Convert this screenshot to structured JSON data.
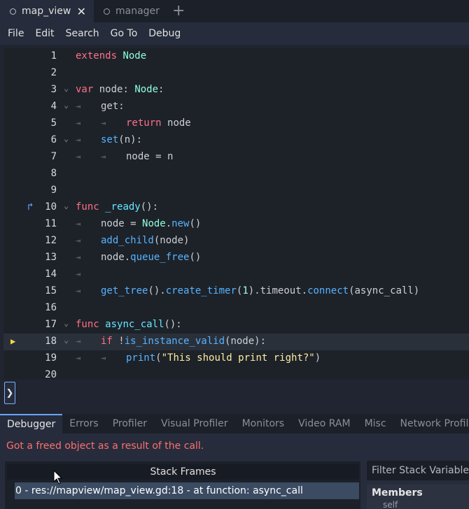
{
  "tabs": [
    {
      "label": "map_view",
      "active": true
    },
    {
      "label": "manager",
      "active": false
    }
  ],
  "menu": [
    "File",
    "Edit",
    "Search",
    "Go To",
    "Debug"
  ],
  "editor": {
    "lines": [
      {
        "n": "1"
      },
      {
        "n": "2"
      },
      {
        "n": "3"
      },
      {
        "n": "4"
      },
      {
        "n": "5"
      },
      {
        "n": "6"
      },
      {
        "n": "7"
      },
      {
        "n": "8"
      },
      {
        "n": "9"
      },
      {
        "n": "10"
      },
      {
        "n": "11"
      },
      {
        "n": "12"
      },
      {
        "n": "13"
      },
      {
        "n": "14"
      },
      {
        "n": "15"
      },
      {
        "n": "16"
      },
      {
        "n": "17"
      },
      {
        "n": "18"
      },
      {
        "n": "19"
      },
      {
        "n": "20"
      }
    ],
    "tokens": {
      "l1": [
        "extends",
        "Node"
      ],
      "l3": [
        "var",
        "node:",
        "Node",
        ":"
      ],
      "l4": [
        "get:"
      ],
      "l5": [
        "return",
        "node"
      ],
      "l6": [
        "set",
        "(n):"
      ],
      "l7": [
        "node = n"
      ],
      "l10": [
        "func",
        "_ready",
        "():"
      ],
      "l11": [
        "node = ",
        "Node",
        ".",
        "new",
        "()"
      ],
      "l12": [
        "add_child",
        "(node)"
      ],
      "l13": [
        "node.",
        "queue_free",
        "()"
      ],
      "l15": [
        "get_tree",
        "().",
        "create_timer",
        "(",
        "1",
        ").timeout.",
        "connect",
        "(async_call)"
      ],
      "l17": [
        "func",
        "async_call",
        "():"
      ],
      "l18": [
        "if",
        " !",
        "is_instance_valid",
        "(node):"
      ],
      "l19": [
        "print",
        "(",
        "\"This should print right?\"",
        ")"
      ]
    }
  },
  "debugger": {
    "tabs": [
      "Debugger",
      "Errors",
      "Profiler",
      "Visual Profiler",
      "Monitors",
      "Video RAM",
      "Misc",
      "Network Profil"
    ],
    "error_message": "Got a freed object as a result of the call.",
    "stack_header": "Stack Frames",
    "stack_row": "0 - res://mapview/map_view.gd:18 - at function: async_call",
    "filter_placeholder": "Filter Stack Variables",
    "members_label": "Members",
    "members_sub": "self"
  },
  "colors": {
    "keyword": "#ff7085",
    "type": "#8effda",
    "function": "#57b3ff",
    "string": "#ffeda1",
    "error": "#ff6f6f",
    "accent": "#6aa4ff"
  },
  "icons": {
    "tab_dot": "circle-icon",
    "tab_close": "close-icon",
    "new_tab": "plus-icon",
    "connected_signal": "signal-connection-icon",
    "breakpoint_arrow": "execution-pointer-icon",
    "fold": "chevron-down-icon",
    "tab_marker": "indent-tab-icon",
    "console_toggle": "chevron-right-icon"
  }
}
